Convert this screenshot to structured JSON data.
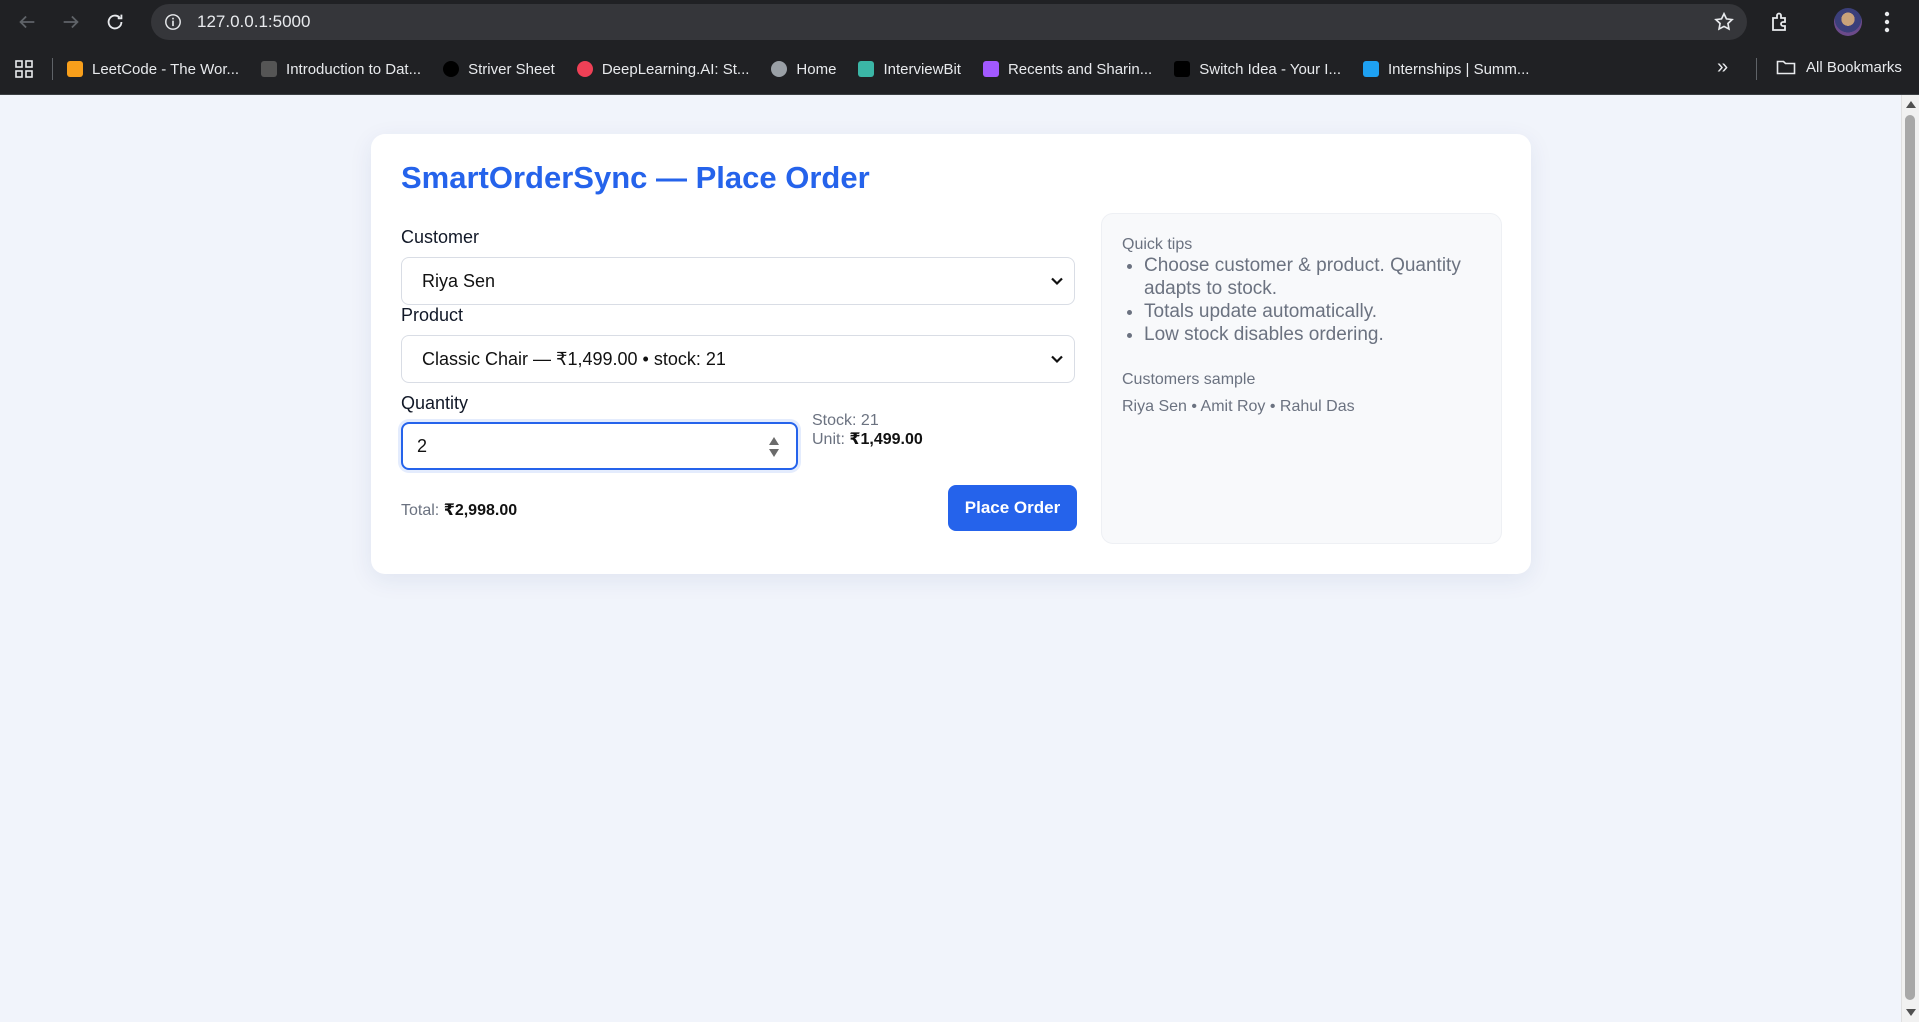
{
  "browser": {
    "url": "127.0.0.1:5000",
    "bookmarks": [
      {
        "label": "LeetCode - The Wor...",
        "color": "#f89f1b"
      },
      {
        "label": "Introduction to Dat...",
        "color": "#555555"
      },
      {
        "label": "Striver Sheet",
        "color": "#000000"
      },
      {
        "label": "DeepLearning.AI: St...",
        "color": "#ef4056"
      },
      {
        "label": "Home",
        "color": "#9aa0a6"
      },
      {
        "label": "InterviewBit",
        "color": "#3bb6a6"
      },
      {
        "label": "Recents and Sharin...",
        "color": "#a259ff"
      },
      {
        "label": "Switch Idea - Your I...",
        "color": "#000000"
      },
      {
        "label": "Internships | Summ...",
        "color": "#1ea1f2"
      }
    ],
    "all_bookmarks": "All Bookmarks"
  },
  "page": {
    "title": "SmartOrderSync — Place Order",
    "customer_label": "Customer",
    "customer_value": "Riya Sen",
    "product_label": "Product",
    "product_value": "Classic Chair — ₹1,499.00 • stock: 21",
    "quantity_label": "Quantity",
    "quantity_value": "2",
    "stock_label": "Stock:",
    "stock_value": "21",
    "unit_label": "Unit:",
    "unit_value": "₹1,499.00",
    "total_label": "Total:",
    "total_value": "₹2,998.00",
    "place_order": "Place Order"
  },
  "tips": {
    "heading": "Quick tips",
    "items": [
      "Choose customer & product. Quantity adapts to stock.",
      "Totals update automatically.",
      "Low stock disables ordering."
    ],
    "sample_heading": "Customers sample",
    "sample_text": "Riya Sen • Amit Roy • Rahul Das"
  },
  "colors": {
    "accent": "#2563eb",
    "page_bg": "#f1f4fb"
  }
}
